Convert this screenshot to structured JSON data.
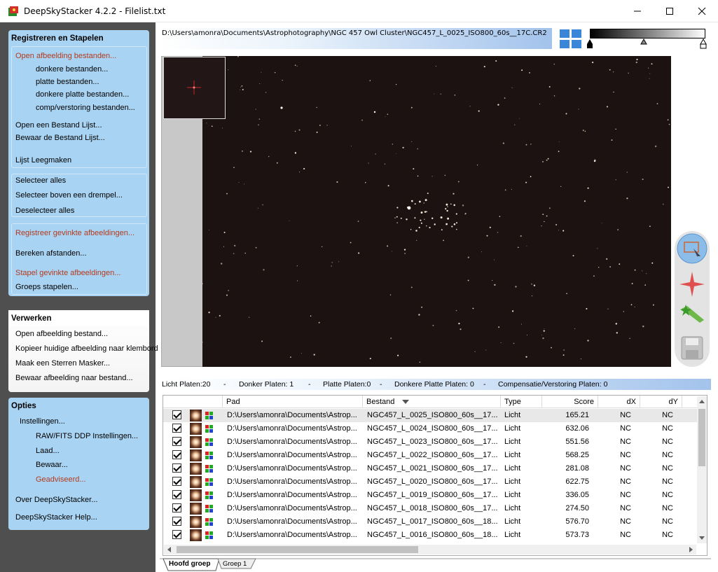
{
  "window": {
    "title": "DeepSkyStacker 4.2.2 - Filelist.txt"
  },
  "sidebar": {
    "register": {
      "heading": "Registreren en Stapelen",
      "open_images": "Open afbeelding bestanden...",
      "dark": "donkere bestanden...",
      "flat": "platte bestanden...",
      "dark_flat": "donkere platte bestanden...",
      "offset": "comp/verstoring bestanden...",
      "open_list": "Open een Bestand Lijst...",
      "save_list": "Bewaar de Bestand Lijst...",
      "clear_list": "Lijst Leegmaken",
      "select_all": "Selecteer alles",
      "select_threshold": "Selecteer boven een drempel...",
      "deselect_all": "Deselecteer alles",
      "register_checked": "Registreer gevinkte afbeeldingen...",
      "compute_offsets": "Bereken afstanden...",
      "stack_checked": "Stapel gevinkte afbeeldingen...",
      "batch_stack": "Groeps stapelen..."
    },
    "process": {
      "heading": "Verwerken",
      "open_image": "Open afbeelding bestand...",
      "copy_clipboard": "Kopieer huidige afbeelding naar klembord",
      "star_mask": "Maak een Sterren Masker...",
      "save_image": "Bewaar afbeelding naar bestand..."
    },
    "options": {
      "heading": "Opties",
      "settings": "Instellingen...",
      "raw_settings": "RAW/FITS DDP Instellingen...",
      "load": "Laad...",
      "save": "Bewaar...",
      "recommended": "Geadviseerd...",
      "about": "Over DeepSkyStacker...",
      "help": "DeepSkyStacker Help..."
    }
  },
  "path_bar": {
    "text": "D:\\Users\\amonra\\Documents\\Astrophotography\\NGC 457 Owl Cluster\\NGC457_L_0025_ISO800_60s__17C.CR2"
  },
  "status": {
    "light": "Licht Platen:20",
    "dark": "Donker Platen: 1",
    "flat": "Platte Platen:0",
    "dark_flat": "Donkere Platte Platen: 0",
    "offset": "Compensatie/Verstoring Platen: 0",
    "sep": "-"
  },
  "table": {
    "headers": {
      "path": "Pad",
      "file": "Bestand",
      "type": "Type",
      "score": "Score",
      "dx": "dX",
      "dy": "dY"
    },
    "rows": [
      {
        "path": "D:\\Users\\amonra\\Documents\\Astrop...",
        "file": "NGC457_L_0025_ISO800_60s__17...",
        "type": "Licht",
        "score": "165.21",
        "dx": "NC",
        "dy": "NC"
      },
      {
        "path": "D:\\Users\\amonra\\Documents\\Astrop...",
        "file": "NGC457_L_0024_ISO800_60s__17...",
        "type": "Licht",
        "score": "632.06",
        "dx": "NC",
        "dy": "NC"
      },
      {
        "path": "D:\\Users\\amonra\\Documents\\Astrop...",
        "file": "NGC457_L_0023_ISO800_60s__17...",
        "type": "Licht",
        "score": "551.56",
        "dx": "NC",
        "dy": "NC"
      },
      {
        "path": "D:\\Users\\amonra\\Documents\\Astrop...",
        "file": "NGC457_L_0022_ISO800_60s__17...",
        "type": "Licht",
        "score": "568.25",
        "dx": "NC",
        "dy": "NC"
      },
      {
        "path": "D:\\Users\\amonra\\Documents\\Astrop...",
        "file": "NGC457_L_0021_ISO800_60s__17...",
        "type": "Licht",
        "score": "281.08",
        "dx": "NC",
        "dy": "NC"
      },
      {
        "path": "D:\\Users\\amonra\\Documents\\Astrop...",
        "file": "NGC457_L_0020_ISO800_60s__17...",
        "type": "Licht",
        "score": "622.75",
        "dx": "NC",
        "dy": "NC"
      },
      {
        "path": "D:\\Users\\amonra\\Documents\\Astrop...",
        "file": "NGC457_L_0019_ISO800_60s__17...",
        "type": "Licht",
        "score": "336.05",
        "dx": "NC",
        "dy": "NC"
      },
      {
        "path": "D:\\Users\\amonra\\Documents\\Astrop...",
        "file": "NGC457_L_0018_ISO800_60s__17...",
        "type": "Licht",
        "score": "274.50",
        "dx": "NC",
        "dy": "NC"
      },
      {
        "path": "D:\\Users\\amonra\\Documents\\Astrop...",
        "file": "NGC457_L_0017_ISO800_60s__18...",
        "type": "Licht",
        "score": "576.70",
        "dx": "NC",
        "dy": "NC"
      },
      {
        "path": "D:\\Users\\amonra\\Documents\\Astrop...",
        "file": "NGC457_L_0016_ISO800_60s__18...",
        "type": "Licht",
        "score": "573.73",
        "dx": "NC",
        "dy": "NC"
      }
    ]
  },
  "tabs": {
    "main": "Hoofd groep",
    "group1": "Groep 1"
  },
  "icons": {
    "tools": [
      "select-rect-icon",
      "add-star-icon",
      "edit-comet-icon",
      "save-icon"
    ]
  }
}
